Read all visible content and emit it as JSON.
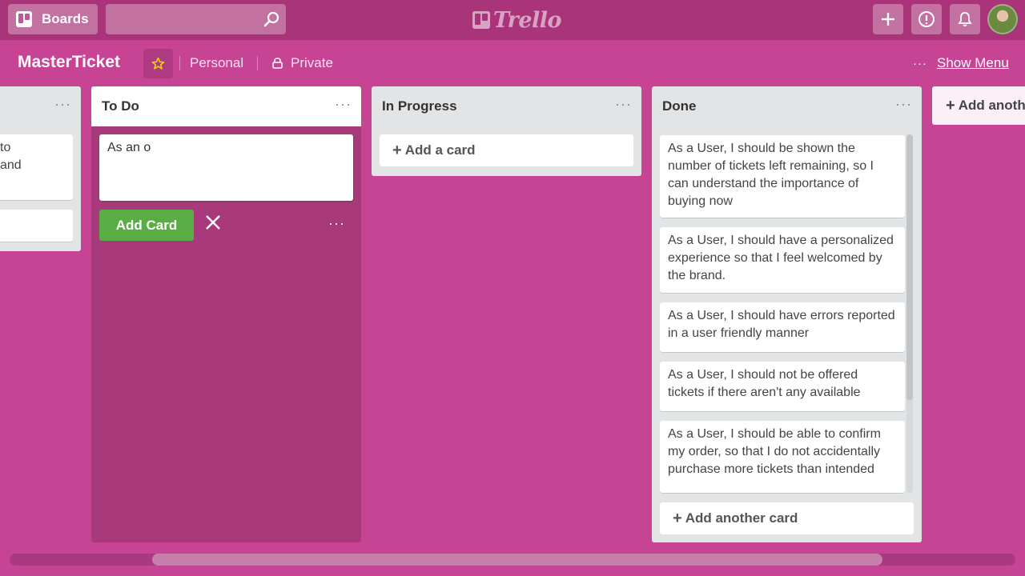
{
  "header": {
    "boards_label": "Boards",
    "search_placeholder": "",
    "logo_text": "Trello",
    "avatar_icon": "user-avatar"
  },
  "board": {
    "title": "MasterTicket",
    "team": "Personal",
    "visibility": "Private",
    "show_menu": "Show Menu",
    "more": "···"
  },
  "lists": {
    "previous": {
      "menu": "···",
      "cards": [
        "to",
        "and",
        ""
      ]
    },
    "todo": {
      "title": "To Do",
      "menu": "···",
      "composer_value": "As an o",
      "add_button": "Add Card",
      "cancel_icon": "close-icon",
      "more": "···"
    },
    "in_progress": {
      "title": "In Progress",
      "menu": "···",
      "add_card": "Add a card"
    },
    "done": {
      "title": "Done",
      "menu": "···",
      "cards": [
        "As a User, I should be shown the number of tickets left remaining, so I can understand the importance of buying now",
        "As a User, I should have a personalized experience so that I feel welcomed by the brand.",
        "As a User, I should have errors reported in a user friendly manner",
        "As a User, I should not be offered tickets if there aren't any available",
        "As a User, I should be able to confirm my order, so that I do not accidentally purchase more tickets than intended"
      ],
      "add_card": "Add another card"
    },
    "add_list": "Add another list"
  },
  "colors": {
    "background": "#c74394",
    "header": "#a93479",
    "add_button": "#5aac44",
    "star": "#f2d600"
  }
}
